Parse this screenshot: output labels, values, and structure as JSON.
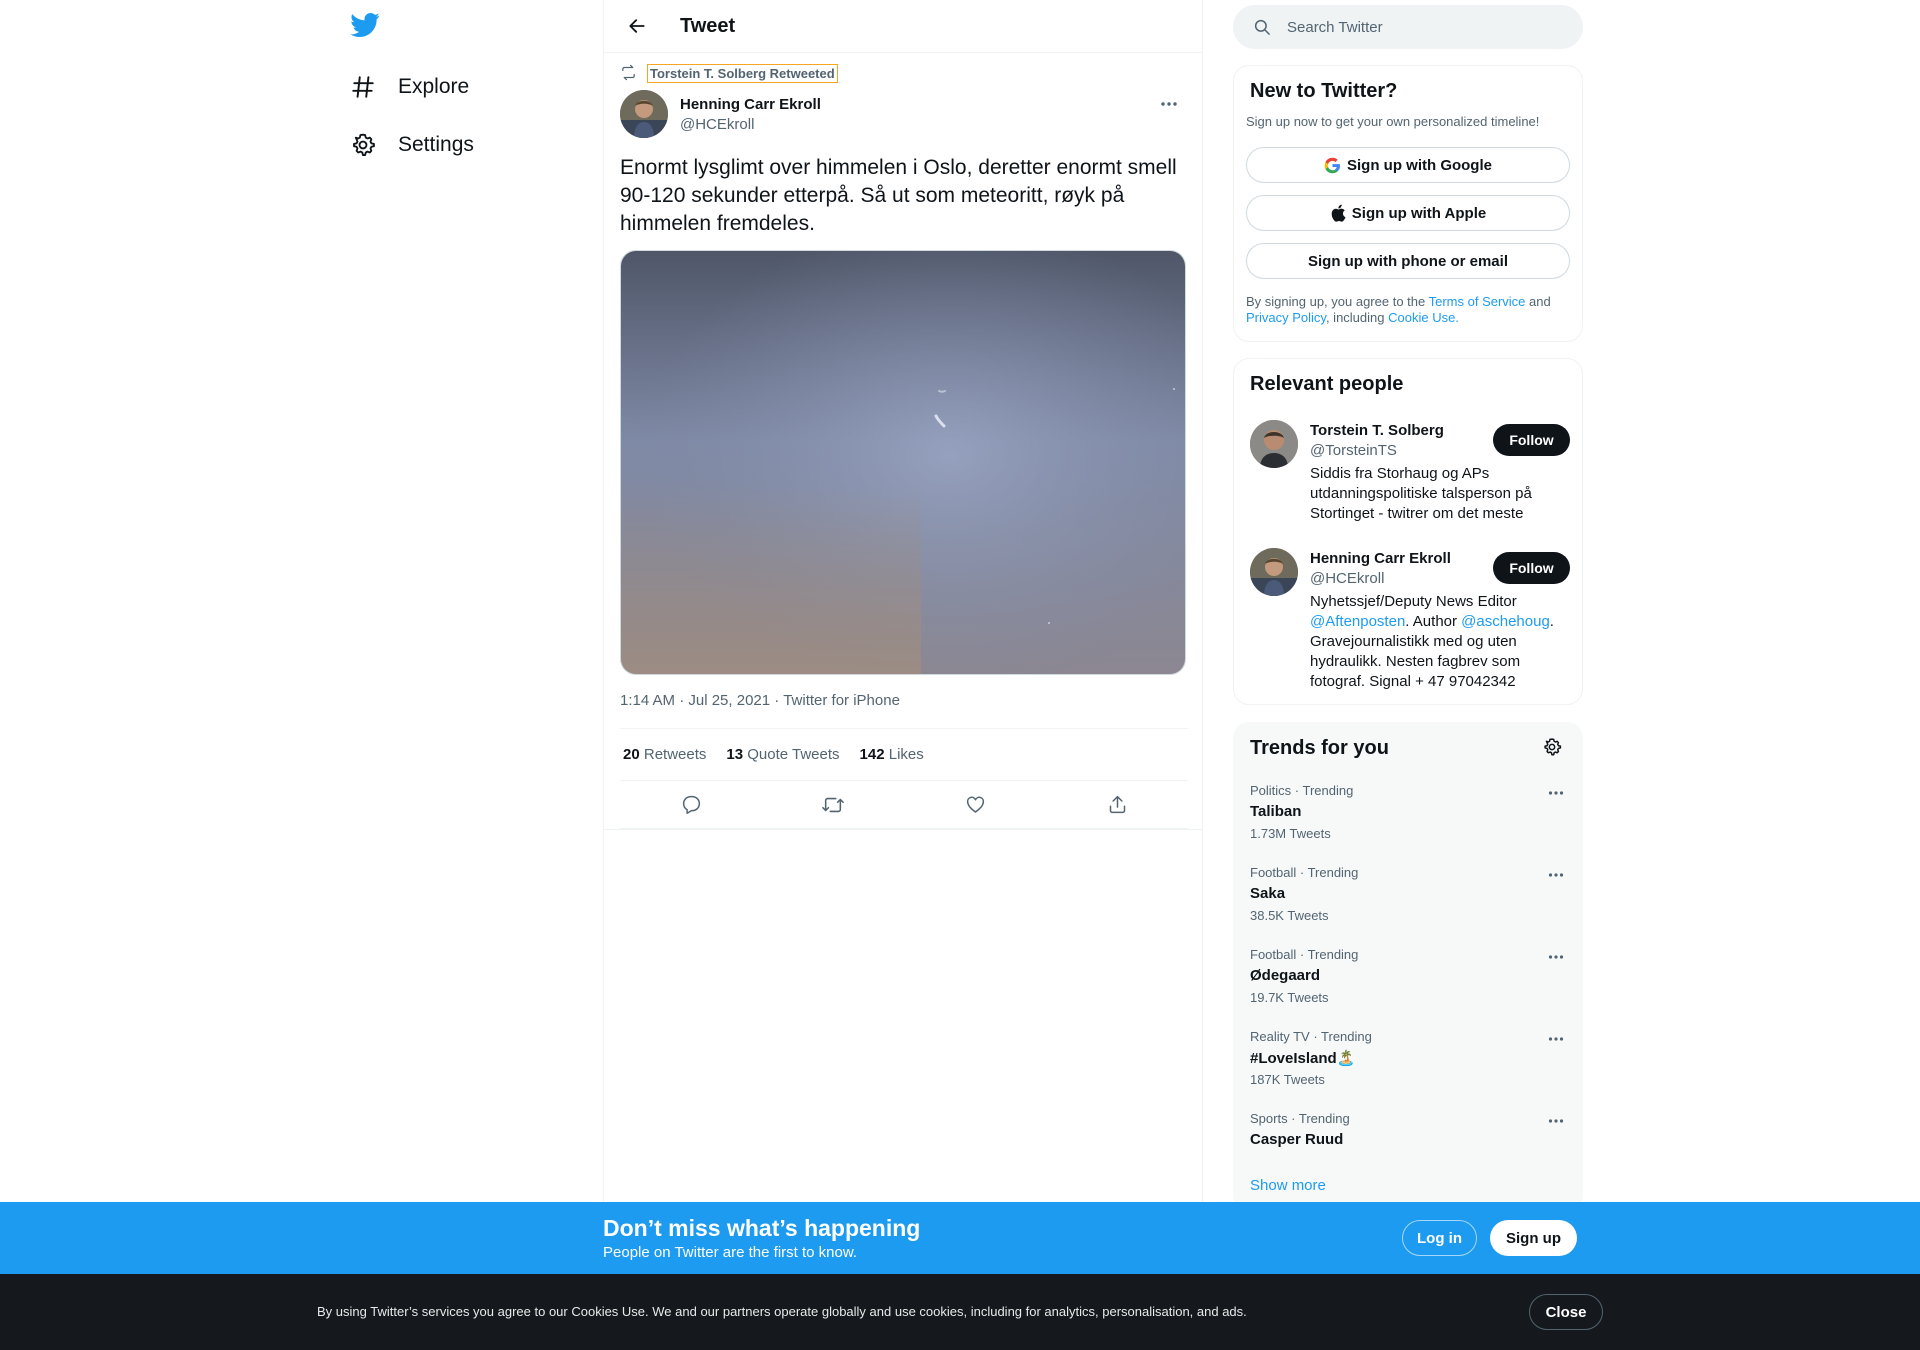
{
  "nav": {
    "logo": "twitter-bird-icon",
    "items": [
      {
        "label": "Explore",
        "icon": "hashtag-icon"
      },
      {
        "label": "Settings",
        "icon": "gear-icon"
      }
    ]
  },
  "header": {
    "title": "Tweet"
  },
  "tweet": {
    "retweeted_by": "Torstein T. Solberg Retweeted",
    "author_name": "Henning Carr Ekroll",
    "author_handle": "@HCEkroll",
    "text": "Enormt lysglimt over himmelen i Oslo, deretter enormt smell 90-120 sekunder etterpå. Så ut som meteoritt, røyk på himmelen fremdeles.",
    "timestamp": "1:14 AM · Jul 25, 2021",
    "source": "Twitter for iPhone",
    "stats": [
      {
        "count": "20",
        "label": "Retweets"
      },
      {
        "count": "13",
        "label": "Quote Tweets"
      },
      {
        "count": "142",
        "label": "Likes"
      }
    ]
  },
  "search": {
    "placeholder": "Search Twitter"
  },
  "new_to_twitter": {
    "title": "New to Twitter?",
    "subtitle": "Sign up now to get your own personalized timeline!",
    "google": "Sign up with Google",
    "apple": "Sign up with Apple",
    "phone": "Sign up with phone or email",
    "legal_1": "By signing up, you agree to the ",
    "terms": "Terms of Service",
    "legal_2": " and",
    "privacy": "Privacy Policy",
    "legal_3": ", including ",
    "cookie": "Cookie Use."
  },
  "relevant_people": {
    "title": "Relevant people",
    "people": [
      {
        "name": "Torstein T. Solberg",
        "handle": "@TorsteinTS",
        "bio": "Siddis fra Storhaug og APs utdanningspolitiske talsperson på Stortinget - twitrer om det meste",
        "follow": "Follow"
      },
      {
        "name": "Henning Carr Ekroll",
        "handle": "@HCEkroll",
        "bio_1": "Nyhetssjef/Deputy News Editor ",
        "bio_link_1": "@Aftenposten",
        "bio_2": ". Author ",
        "bio_link_2": "@aschehoug",
        "bio_3": ". Gravejournalistikk med og uten hydraulikk. Nesten fagbrev som fotograf. Signal + 47 97042342",
        "follow": "Follow"
      }
    ]
  },
  "trends": {
    "title": "Trends for you",
    "items": [
      {
        "category": "Politics · Trending",
        "name": "Taliban",
        "count": "1.73M Tweets"
      },
      {
        "category": "Football · Trending",
        "name": "Saka",
        "count": "38.5K Tweets"
      },
      {
        "category": "Football · Trending",
        "name": "Ødegaard",
        "count": "19.7K Tweets"
      },
      {
        "category": "Reality TV · Trending",
        "name": "#LoveIsland🏝️",
        "count": "187K Tweets"
      },
      {
        "category": "Sports · Trending",
        "name": "Casper Ruud",
        "count": ""
      }
    ],
    "show_more": "Show more"
  },
  "bottom_bar": {
    "title": "Don’t miss what’s happening",
    "subtitle": "People on Twitter are the first to know.",
    "login": "Log in",
    "signup": "Sign up"
  },
  "cookie_bar": {
    "text": "By using Twitter’s services you agree to our Cookies Use. We and our partners operate globally and use cookies, including for analytics, personalisation, and ads.",
    "close": "Close"
  },
  "colors": {
    "accent": "#1d9bf0",
    "text": "#0f1419",
    "muted": "#536471",
    "cookie_bg": "#15181c"
  }
}
